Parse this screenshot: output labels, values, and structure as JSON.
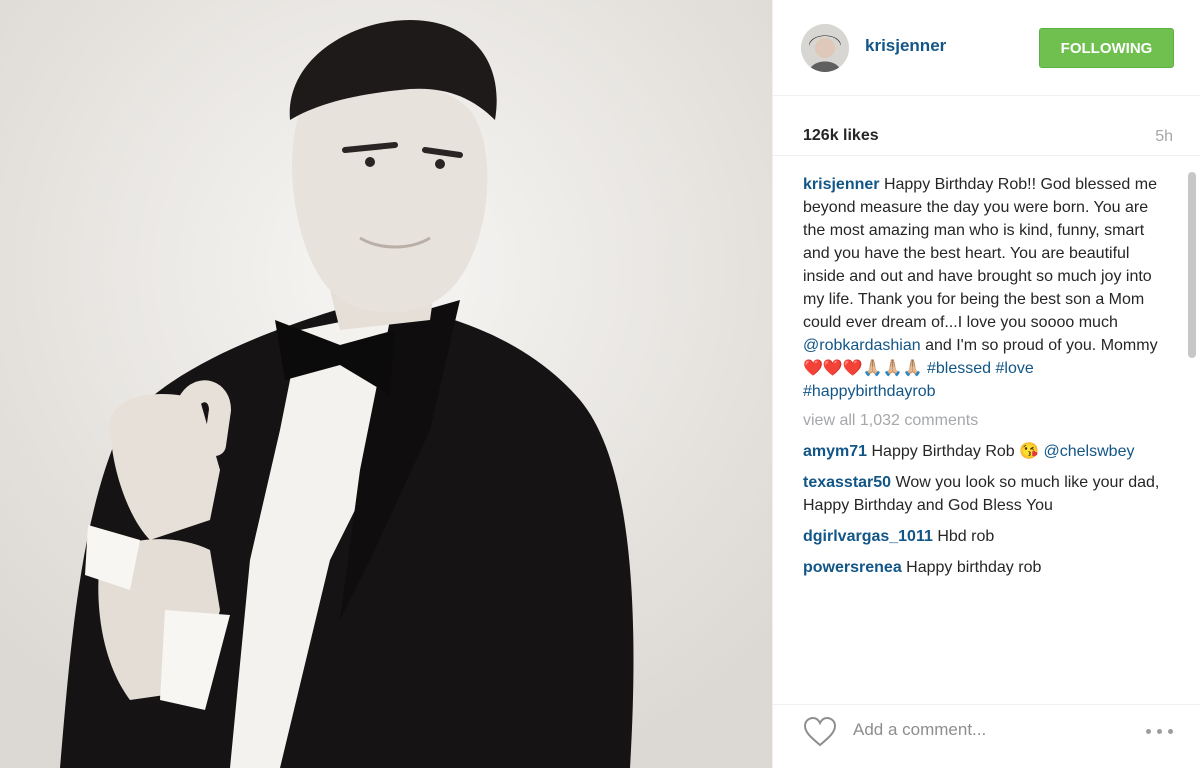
{
  "post": {
    "username": "krisjenner",
    "follow_button": "FOLLOWING",
    "likes": "126k likes",
    "time": "5h",
    "caption": {
      "user": "krisjenner",
      "text1": "Happy Birthday Rob!! God blessed me beyond measure the day you were born. You are the most amazing man who is kind, funny, smart and you have the best heart. You are beautiful inside and out and have brought so much joy into my life. Thank you for being the best son a Mom could ever dream of...I love you soooo much",
      "mention": "@robkardashian",
      "text2": "and I'm so proud of you. Mommy",
      "emoji": "❤️❤️❤️🙏🏼🙏🏼🙏🏼",
      "tags": [
        "#blessed",
        "#love",
        "#happybirthdayrob"
      ]
    },
    "view_all": "view all 1,032 comments",
    "comments": [
      {
        "user": "amym71",
        "text": "Happy Birthday Rob 😘",
        "mention": "@chelswbey"
      },
      {
        "user": "texasstar50",
        "text": "Wow you look so much like your dad, Happy Birthday and God Bless You"
      },
      {
        "user": "dgirlvargas_1011",
        "text": "Hbd rob"
      },
      {
        "user": "powersrenea",
        "text": "Happy birthday rob"
      }
    ],
    "add_comment_placeholder": "Add a comment..."
  },
  "colors": {
    "link": "#125688",
    "follow_green": "#70c050",
    "muted": "#a5a7aa"
  },
  "icons": {
    "heart": "heart-icon",
    "more": "more-options-icon",
    "avatar": "profile-avatar"
  }
}
